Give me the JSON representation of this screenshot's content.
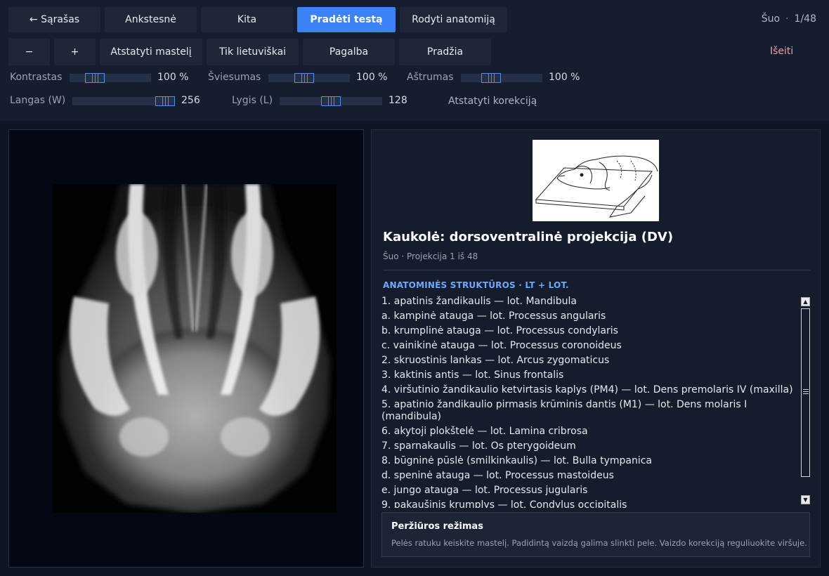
{
  "toolbar": {
    "back_label": "← Sąrašas",
    "prev_label": "Ankstesnė",
    "next_label": "Kita",
    "start_test_label": "Pradėti testą",
    "show_anatomy_label": "Rodyti anatomiją",
    "zoom_out_label": "−",
    "zoom_in_label": "+",
    "reset_zoom_label": "Atstatyti mastelį",
    "lt_only_label": "Tik lietuviškai",
    "help_label": "Pagalba",
    "home_label": "Pradžia",
    "quit_label": "Išeiti"
  },
  "counter": {
    "species": "Šuo",
    "separator": "·",
    "position": "1/48"
  },
  "adjustments": {
    "contrast": {
      "label": "Kontrastas",
      "value_text": "100 %",
      "level": 0.2
    },
    "brightness": {
      "label": "Šviesumas",
      "value_text": "100 %",
      "level": 0.33
    },
    "sharpness": {
      "label": "Aštrumas",
      "value_text": "100 %",
      "level": 0.33
    },
    "window": {
      "label": "Langas (W)",
      "value_text": "256",
      "level": 0.9
    },
    "level": {
      "label": "Lygis (L)",
      "value_text": "128",
      "level": 0.48
    },
    "reset_label": "Atstatyti korekciją"
  },
  "panel": {
    "title": "Kaukolė: dorsoventralinė projekcija (DV)",
    "subtitle": "Šuo · Projekcija 1 iš 48",
    "section_heading": "ANATOMINĖS STRUKTŪROS · LT + LOT.",
    "structures": [
      "1. apatinis žandikaulis — lot. Mandibula",
      "a. kampinė atauga — lot. Processus angularis",
      "b. krumplinė atauga — lot. Processus condylaris",
      "c. vainikinė atauga — lot. Processus coronoideus",
      "2. skruostinis lankas — lot. Arcus zygomaticus",
      "3. kaktinis antis — lot. Sinus frontalis",
      "4. viršutinio žandikaulio ketvirtasis kaplys (PM4) — lot. Dens premolaris IV (maxilla)",
      "5. apatinio žandikaulio pirmasis krūminis dantis (M1) — lot. Dens molaris I (mandibula)",
      "6. akytoji plokštelė — lot. Lamina cribrosa",
      "7. sparnakaulis — lot. Os pterygoideum",
      "8. būgninė pūslė (smilkinkaulis) — lot. Bulla tympanica",
      "d. speninė atauga — lot. Processus mastoideus",
      "e. jungo atauga — lot. Processus jugularis",
      "9. pakaušinis krumplys — lot. Condylus occipitalis"
    ],
    "info_heading": "Peržiūros režimas",
    "info_text": "Pelės ratuku keiskite mastelį. Padidintą vaizdą galima slinkti pele. Vaizdo korekciją reguliuokite viršuje."
  }
}
